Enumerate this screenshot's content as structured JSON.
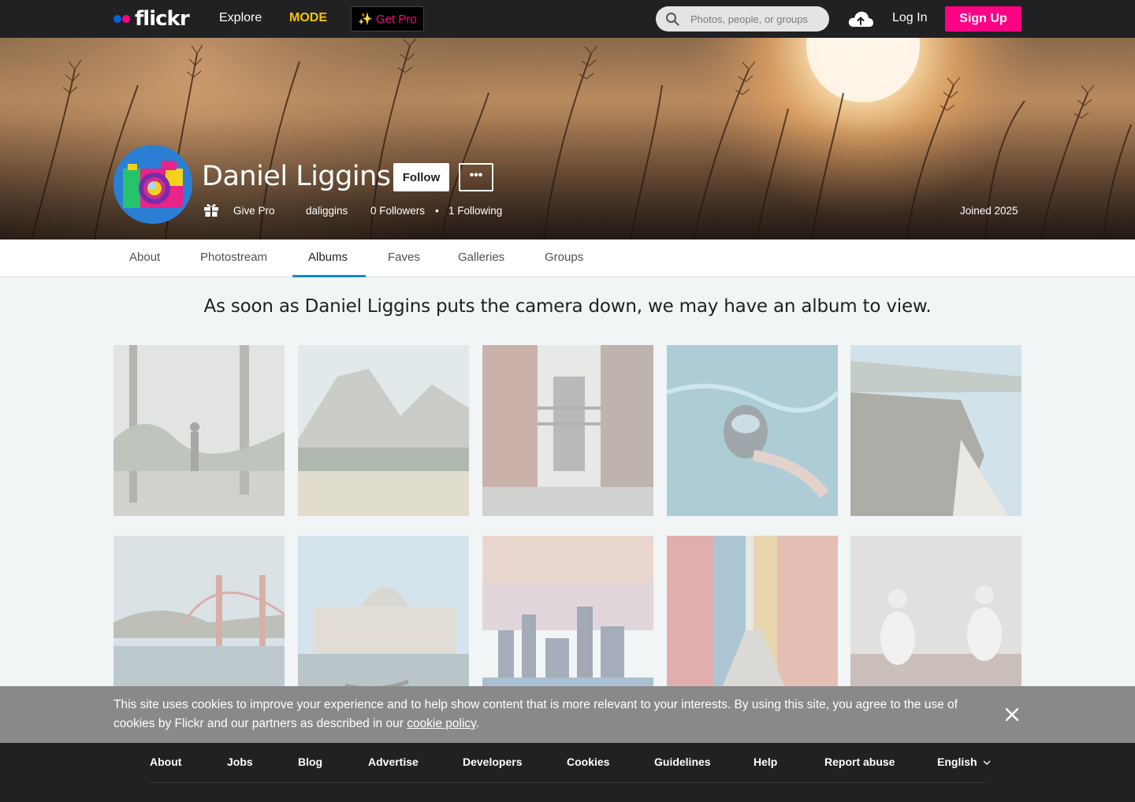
{
  "nav": {
    "logo_text": "flickr",
    "explore_label": "Explore",
    "mode_label": "MODE",
    "get_pro_label": "Get Pro",
    "search_placeholder": "Photos, people, or groups",
    "login_label": "Log In",
    "signup_label": "Sign Up",
    "colors": {
      "bar": "#212124",
      "brand_blue": "#0063dc",
      "brand_pink": "#ff0084",
      "mode_yellow": "#f5c400"
    }
  },
  "profile": {
    "name": "Daniel Liggins",
    "follow_label": "Follow",
    "more_label": "•••",
    "give_pro_label": "Give Pro",
    "username": "daliggins",
    "followers": "0 Followers",
    "separator": "•",
    "following": "1 Following",
    "joined": "Joined 2025"
  },
  "tabs": [
    {
      "label": "About",
      "active": false
    },
    {
      "label": "Photostream",
      "active": false
    },
    {
      "label": "Albums",
      "active": true
    },
    {
      "label": "Faves",
      "active": false
    },
    {
      "label": "Galleries",
      "active": false
    },
    {
      "label": "Groups",
      "active": false
    }
  ],
  "albums": {
    "empty_message": "As soon as Daniel Liggins puts the camera down, we may have an album to view.",
    "placeholder_tiles": [
      "hiker-on-rocky-trail",
      "yosemite-valley-meadow",
      "manhattan-bridge-street",
      "underwater-snorkeler",
      "big-sur-coastline",
      "golden-gate-bridge",
      "venice-gondola",
      "city-skyline-sunset",
      "colorful-alley",
      "blue-footed-boobies"
    ]
  },
  "cookie_banner": {
    "text_before": "This site uses cookies to improve your experience and to help show content that is more relevant to your interests. By using this site, you agree to the use of cookies by Flickr and our partners as described in our ",
    "link_label": "cookie policy",
    "text_after": "."
  },
  "footer": {
    "links": [
      "About",
      "Jobs",
      "Blog",
      "Advertise",
      "Developers",
      "Cookies",
      "Guidelines",
      "Help",
      "Report abuse"
    ],
    "language": "English"
  }
}
